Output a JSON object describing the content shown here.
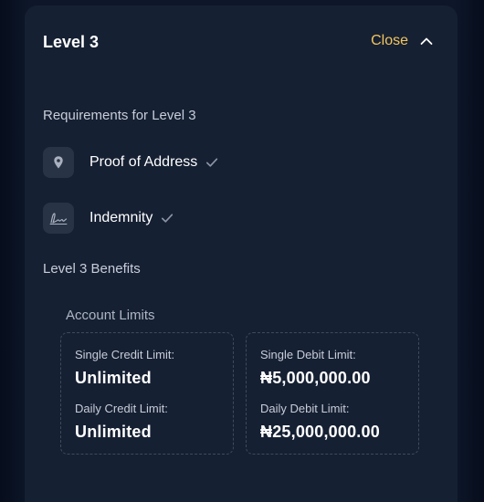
{
  "header": {
    "title": "Level 3",
    "close_label": "Close"
  },
  "requirements": {
    "heading": "Requirements for Level 3",
    "items": [
      {
        "label": "Proof of Address",
        "icon": "location-pin-icon"
      },
      {
        "label": "Indemnity",
        "icon": "signature-icon"
      }
    ]
  },
  "benefits": {
    "heading": "Level 3 Benefits",
    "limits_title": "Account Limits",
    "credit": {
      "single_label": "Single Credit Limit:",
      "single_value": "Unlimited",
      "daily_label": "Daily Credit Limit:",
      "daily_value": "Unlimited"
    },
    "debit": {
      "single_label": "Single Debit Limit:",
      "single_value": "₦5,000,000.00",
      "daily_label": "Daily Debit Limit:",
      "daily_value": "₦25,000,000.00"
    }
  },
  "colors": {
    "accent": "#f1c65e",
    "card_bg": "#162033",
    "page_bg": "#0d1729"
  }
}
